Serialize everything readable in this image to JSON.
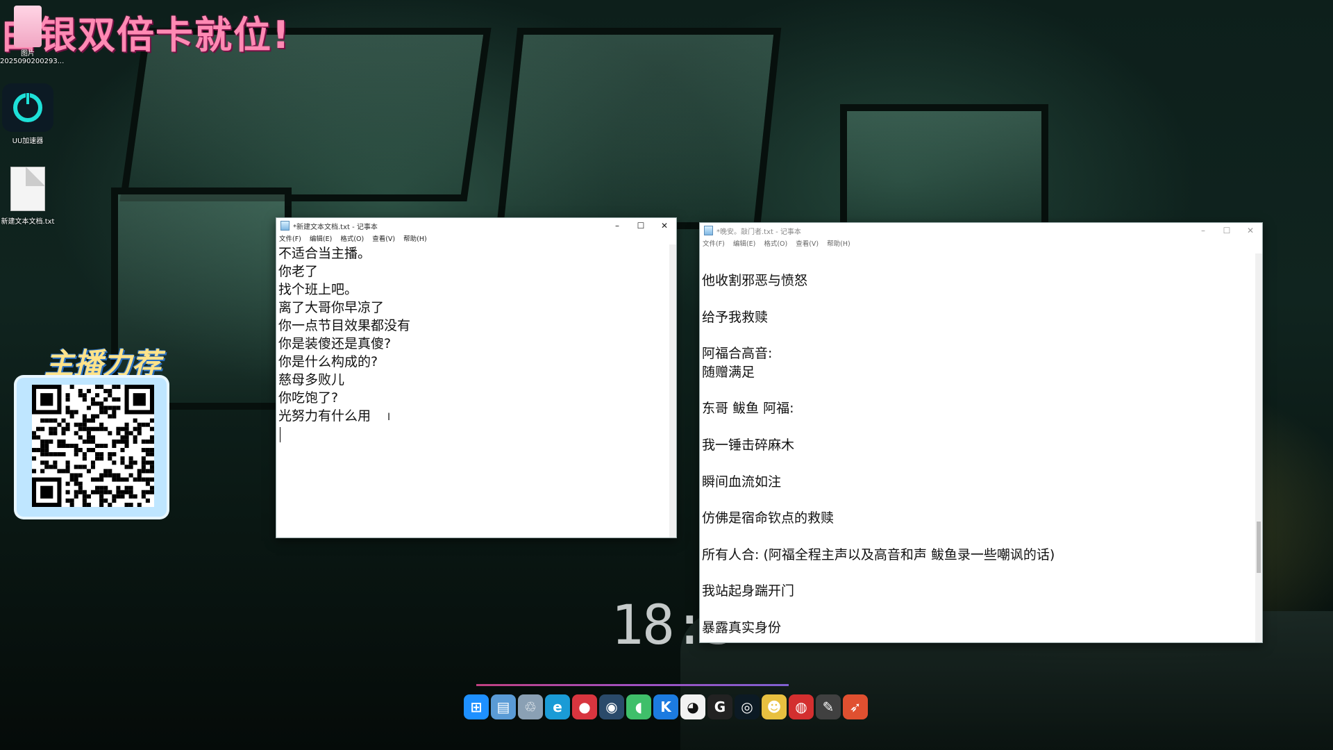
{
  "banner": {
    "text": "白银双倍卡就位!"
  },
  "desktop_icons": [
    {
      "name": "photo",
      "label1": "图片",
      "label2": "2025090200293..."
    },
    {
      "name": "uu",
      "label1": "UU加速器"
    },
    {
      "name": "txt",
      "label1": "新建文本文档.txt"
    }
  ],
  "qr_panel": {
    "title": "主播力荐"
  },
  "clock": {
    "time": "18:5"
  },
  "notepad1": {
    "title": "*新建文本文档.txt - 记事本",
    "menus": [
      "文件(F)",
      "编辑(E)",
      "格式(O)",
      "查看(V)",
      "帮助(H)"
    ],
    "lines": [
      "不适合当主播。",
      "你老了",
      "找个班上吧。",
      "离了大哥你早凉了",
      "你一点节目效果都没有",
      "你是装傻还是真傻?",
      "你是什么构成的?",
      "慈母多败儿",
      "你吃饱了?",
      "光努力有什么用"
    ]
  },
  "notepad2": {
    "title": "*晚安。敲门者.txt - 记事本",
    "menus": [
      "文件(F)",
      "编辑(E)",
      "格式(O)",
      "查看(V)",
      "帮助(H)"
    ],
    "lines": [
      "",
      "他收割邪恶与愤怒",
      "",
      "给予我救赎",
      "",
      "阿福合高音:",
      "随赠满足",
      "",
      "东哥 鲅鱼 阿福:",
      "",
      "我一锤击碎麻木",
      "",
      "瞬间血流如注",
      "",
      "仿佛是宿命钦点的救赎",
      "",
      "所有人合: (阿福全程主声以及高音和声 鲅鱼录一些嘲讽的话)",
      "",
      "我站起身踹开门",
      "",
      "暴露真实身份"
    ]
  },
  "window_controls": {
    "minimize": "–",
    "maximize": "☐",
    "close": "✕"
  },
  "dock": {
    "items": [
      {
        "name": "windows-start",
        "glyph": "⊞",
        "color": "#1e90ff"
      },
      {
        "name": "file-manager",
        "glyph": "▤",
        "color": "#5a9bd6"
      },
      {
        "name": "recycle-bin",
        "glyph": "♲",
        "color": "#8aa0b4"
      },
      {
        "name": "edge",
        "glyph": "e",
        "color": "#1a9bd6"
      },
      {
        "name": "app-red-bird",
        "glyph": "●",
        "color": "#d8353f"
      },
      {
        "name": "steam",
        "glyph": "◉",
        "color": "#2a4a6a"
      },
      {
        "name": "app-egg",
        "glyph": "◖",
        "color": "#3fbf6a"
      },
      {
        "name": "kugou",
        "glyph": "K",
        "color": "#1c7be0"
      },
      {
        "name": "qq",
        "glyph": "◕",
        "color": "#f2f2f2"
      },
      {
        "name": "app-g",
        "glyph": "G",
        "color": "#222222"
      },
      {
        "name": "uu-accelerator",
        "glyph": "◎",
        "color": "#0c1a24"
      },
      {
        "name": "app-panda",
        "glyph": "☻",
        "color": "#e8c040"
      },
      {
        "name": "netease-music",
        "glyph": "◍",
        "color": "#d32f2f"
      },
      {
        "name": "app-notes",
        "glyph": "✎",
        "color": "#404040"
      },
      {
        "name": "app-bird",
        "glyph": "➶",
        "color": "#e05030"
      }
    ]
  }
}
